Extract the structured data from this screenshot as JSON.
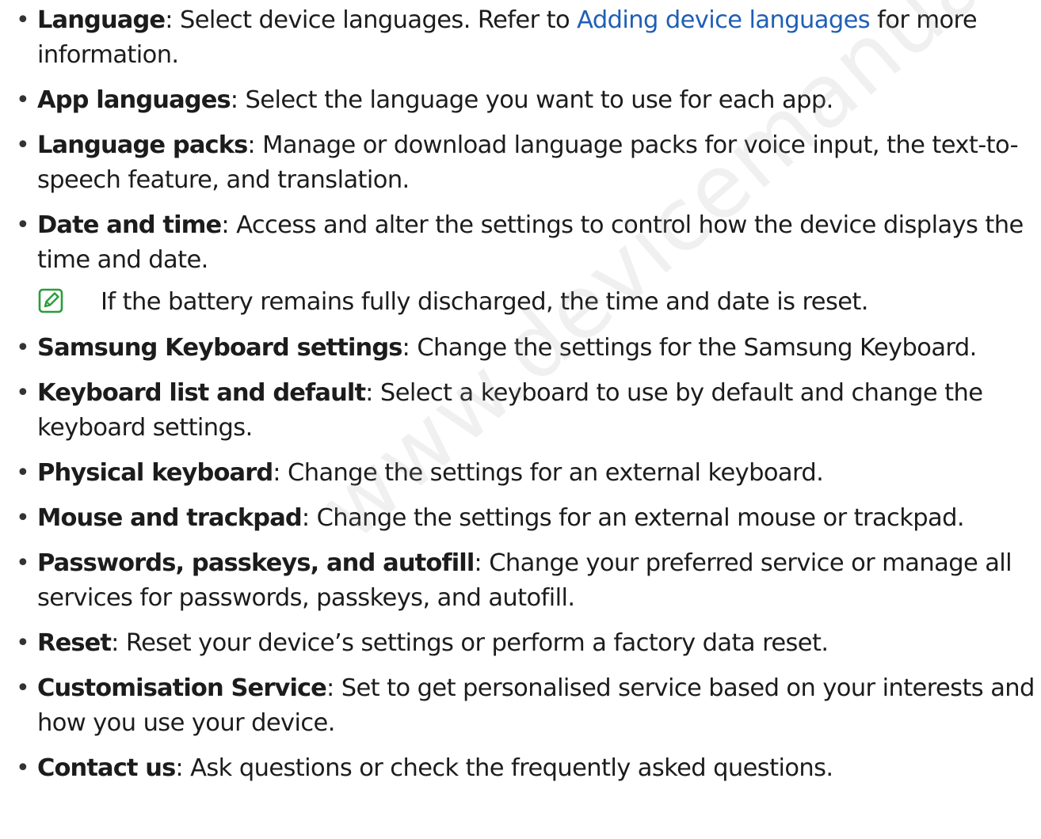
{
  "items": [
    {
      "term": "Language",
      "text_before": ": Select device languages. Refer to ",
      "link": "Adding device languages",
      "text_after": " for more information."
    },
    {
      "term": "App languages",
      "text": ": Select the language you want to use for each app."
    },
    {
      "term": "Language packs",
      "text": ": Manage or download language packs for voice input, the text-to-speech feature, and translation."
    },
    {
      "term": "Date and time",
      "text": ": Access and alter the settings to control how the device displays the time and date."
    },
    {
      "term": "Samsung Keyboard settings",
      "text": ": Change the settings for the Samsung Keyboard."
    },
    {
      "term": "Keyboard list and default",
      "text": ": Select a keyboard to use by default and change the keyboard settings."
    },
    {
      "term": "Physical keyboard",
      "text": ": Change the settings for an external keyboard."
    },
    {
      "term": "Mouse and trackpad",
      "text": ": Change the settings for an external mouse or trackpad."
    },
    {
      "term": "Passwords, passkeys, and autofill",
      "text": ": Change your preferred service or manage all services for passwords, passkeys, and autofill."
    },
    {
      "term": "Reset",
      "text": ": Reset your device’s settings or perform a factory data reset."
    },
    {
      "term": "Customisation Service",
      "text": ": Set to get personalised service based on your interests and how you use your device."
    },
    {
      "term": "Contact us",
      "text": ": Ask questions or check the frequently asked questions."
    }
  ],
  "note": {
    "icon": "note-pencil-icon",
    "text": "If the battery remains fully discharged, the time and date is reset."
  },
  "bullet_char": "•",
  "watermark": "www.devicemanuals.eu",
  "colors": {
    "link": "#1f5fb5",
    "note_icon": "#2a9d3a",
    "text": "#1c1c1c"
  }
}
